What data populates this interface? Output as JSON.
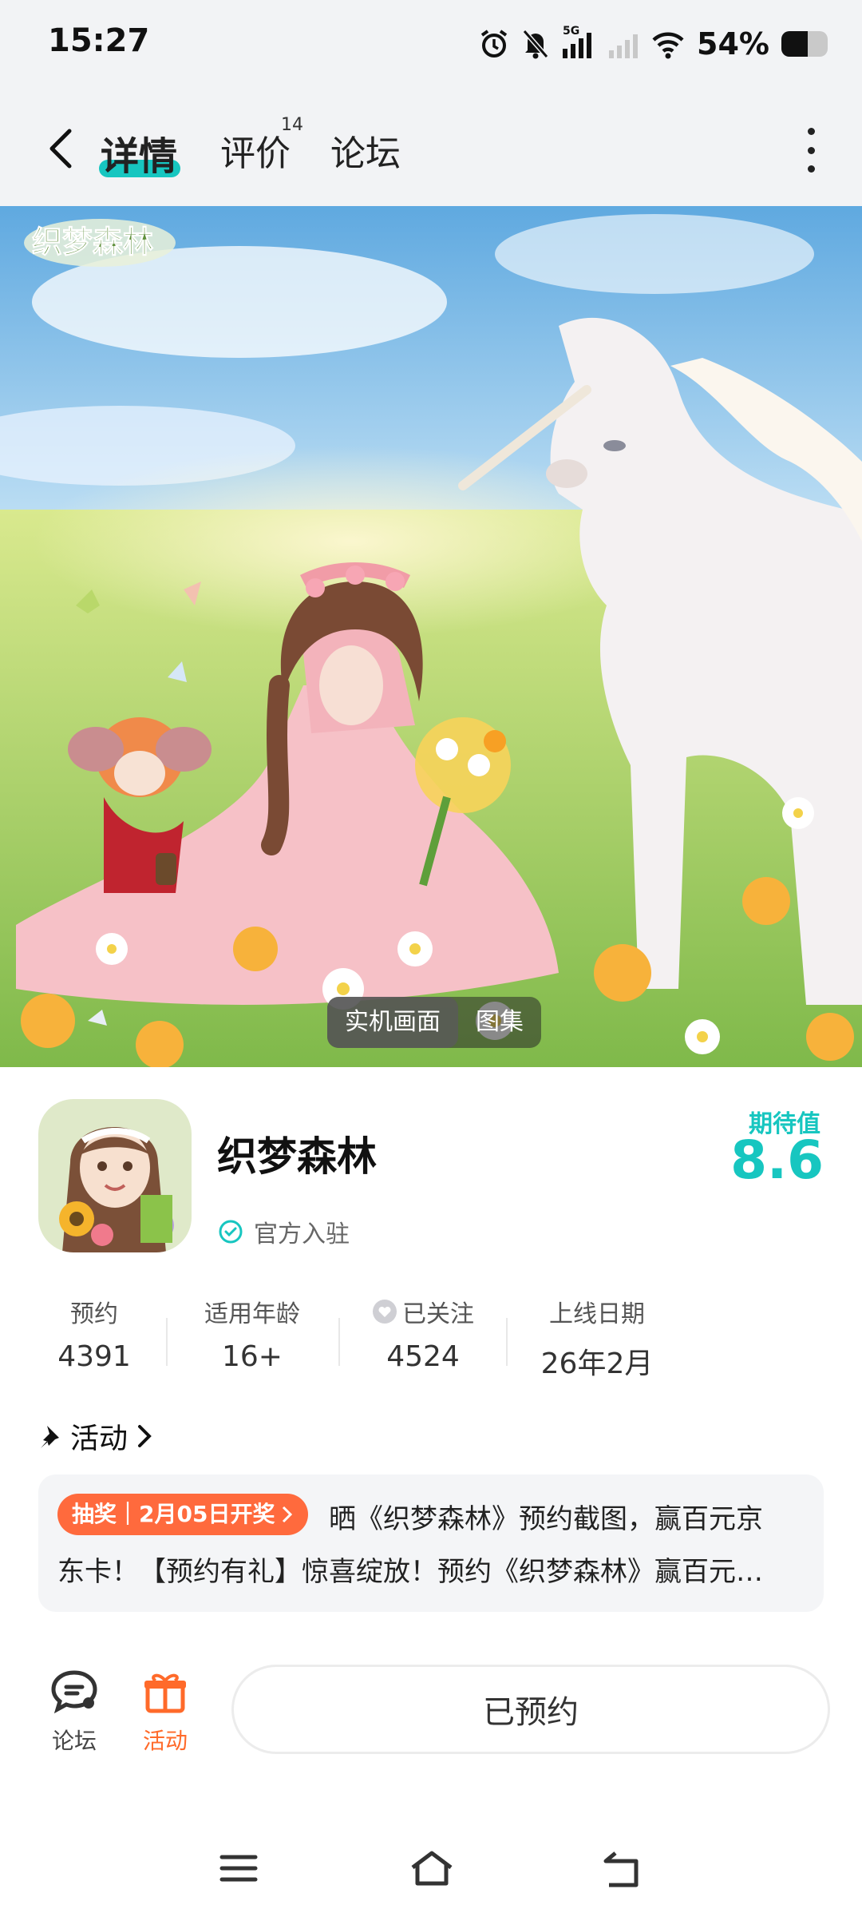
{
  "status_bar": {
    "time": "15:27",
    "network": "5G",
    "battery": "54%"
  },
  "nav": {
    "tabs": [
      {
        "label": "详情",
        "active": true
      },
      {
        "label": "评价",
        "badge": "14"
      },
      {
        "label": "论坛"
      }
    ]
  },
  "banner": {
    "logo_text": "织梦森林",
    "chips": [
      {
        "label": "实机画面",
        "active": true
      },
      {
        "label": "图集"
      }
    ]
  },
  "app": {
    "name": "织梦森林",
    "official": "官方入驻",
    "expect_label": "期待值",
    "expect_value": "8.6"
  },
  "stats": [
    {
      "label": "预约",
      "value": "4391"
    },
    {
      "label": "适用年龄",
      "value": "16+"
    },
    {
      "label": "已关注",
      "value": "4524"
    },
    {
      "label": "上线日期",
      "value": "26年2月"
    }
  ],
  "activity": {
    "title": "活动",
    "tag": "抽奖｜2月05日开奖",
    "line1": "晒《织梦森林》预约截图，赢百元京",
    "line2": "东卡！【预约有礼】惊喜绽放！预约《织梦森林》赢百元…"
  },
  "bottom_bar": {
    "forum_label": "论坛",
    "activity_label": "活动",
    "reserve_label": "已预约"
  },
  "colors": {
    "accent": "#17c6c0",
    "orange": "#ff6a3d"
  }
}
